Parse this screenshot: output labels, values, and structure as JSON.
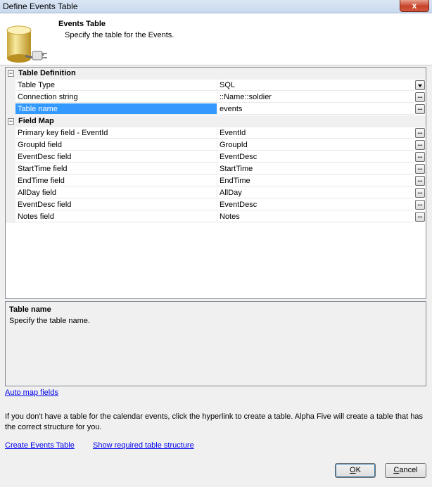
{
  "window": {
    "title": "Define Events Table",
    "close_label": "x"
  },
  "header": {
    "title": "Events Table",
    "subtitle": "Specify the table for the Events."
  },
  "grid": {
    "categories": [
      {
        "label": "Table Definition",
        "properties": [
          {
            "name": "Table Type",
            "value": "SQL",
            "editor": "dropdown"
          },
          {
            "name": "Connection string",
            "value": "::Name::soldier",
            "editor": "ellipsis"
          },
          {
            "name": "Table name",
            "value": "events",
            "editor": "ellipsis",
            "selected": true
          }
        ]
      },
      {
        "label": "Field Map",
        "properties": [
          {
            "name": "Primary key field - EventId",
            "value": "EventId",
            "editor": "ellipsis"
          },
          {
            "name": "GroupId field",
            "value": "GroupId",
            "editor": "ellipsis"
          },
          {
            "name": "EventDesc field",
            "value": "EventDesc",
            "editor": "ellipsis"
          },
          {
            "name": "StartTime field",
            "value": "StartTime",
            "editor": "ellipsis"
          },
          {
            "name": "EndTime field",
            "value": "EndTime",
            "editor": "ellipsis"
          },
          {
            "name": "AllDay field",
            "value": "AllDay",
            "editor": "ellipsis"
          },
          {
            "name": "EventDesc field",
            "value": "EventDesc",
            "editor": "ellipsis"
          },
          {
            "name": "Notes field",
            "value": "Notes",
            "editor": "ellipsis"
          }
        ]
      }
    ],
    "collapse_glyph": "−",
    "ellipsis_glyph": "..."
  },
  "description": {
    "title": "Table name",
    "text": "Specify the table name."
  },
  "links": {
    "auto_map": "Auto map fields",
    "create_table": "Create Events Table",
    "show_structure": "Show required table structure"
  },
  "info_text": "If you don't have a table for the calendar events, click the hyperlink to create a table. Alpha Five will create a table that has the correct structure for you.",
  "buttons": {
    "ok_prefix": "",
    "ok_underline": "O",
    "ok_suffix": "K",
    "cancel_prefix": "",
    "cancel_underline": "C",
    "cancel_suffix": "ancel"
  }
}
